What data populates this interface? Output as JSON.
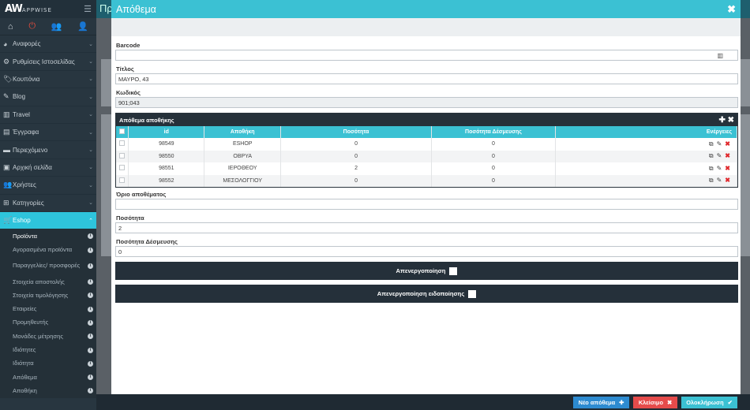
{
  "sidebar": {
    "logo": "AW",
    "logo_sub": "APPWISE",
    "items": [
      {
        "label": "Αναφορές",
        "icon": "pie-chart-icon"
      },
      {
        "label": "Ρυθμίσεις Ιστοσελίδας",
        "icon": "gear-icon"
      },
      {
        "label": "Κουπόνια",
        "icon": "tag-icon"
      },
      {
        "label": "Blog",
        "icon": "pencil-icon"
      },
      {
        "label": "Travel",
        "icon": "suitcase-icon"
      },
      {
        "label": "Έγγραφα",
        "icon": "file-icon"
      },
      {
        "label": "Περιεχόμενο",
        "icon": "folder-icon"
      },
      {
        "label": "Αρχική σελίδα",
        "icon": "image-icon"
      },
      {
        "label": "Χρήστες",
        "icon": "users-icon"
      },
      {
        "label": "Κατηγορίες",
        "icon": "sitemap-icon"
      }
    ],
    "active": {
      "label": "Eshop",
      "icon": "cart-icon"
    },
    "sub": [
      "Προϊόντα",
      "Αγορασμένα προϊόντα",
      "Παραγγελίες/ προσφορές",
      "Στοιχεία αποστολής",
      "Στοιχεία τιμολόγησης",
      "Εταιρείες",
      "Προμηθευτής",
      "Μονάδες μέτρησης",
      "Ιδιότητες",
      "Ιδιότητα",
      "Απόθεμα",
      "Αποθήκη"
    ]
  },
  "modal": {
    "title": "Απόθεμα",
    "barcode": {
      "label": "Barcode",
      "value": ""
    },
    "title_field": {
      "label": "Τίτλος",
      "value": "ΜΑΥΡΟ, 43"
    },
    "code": {
      "label": "Κωδικός",
      "value": "901;043"
    },
    "stock_table": {
      "title": "Απόθεμα αποθήκης",
      "columns": [
        "id",
        "Αποθήκη",
        "Ποσότητα",
        "Ποσότητα Δέσμευσης",
        "Ενέργειες"
      ],
      "rows": [
        {
          "id": "98549",
          "warehouse": "ESHOP",
          "qty": "0",
          "reserved": "0"
        },
        {
          "id": "98550",
          "warehouse": "ΟΒΡΥΑ",
          "qty": "0",
          "reserved": "0"
        },
        {
          "id": "98551",
          "warehouse": "ΙΕΡΟΘΕΟΥ",
          "qty": "2",
          "reserved": "0"
        },
        {
          "id": "98552",
          "warehouse": "ΜΕΣΟΛΟΓΓΙΟΥ",
          "qty": "0",
          "reserved": "0"
        }
      ]
    },
    "limit": {
      "label": "Όριο αποθέματος",
      "value": ""
    },
    "quantity": {
      "label": "Ποσότητα",
      "value": "2"
    },
    "reserved": {
      "label": "Ποσότητα Δέσμευσης",
      "value": "0"
    },
    "disable_label": "Απενεργοποίηση",
    "disable_notify_label": "Απενεργοποίηση ειδοποίησης"
  },
  "bg_title": "Πρ",
  "footer": {
    "new_label": "Νέο απόθεμα",
    "close_label": "Κλείσιμο",
    "complete_label": "Ολοκλήρωση"
  },
  "colors": {
    "accent": "#3bc1d3",
    "danger": "#e54b4b",
    "dark": "#25303a"
  }
}
